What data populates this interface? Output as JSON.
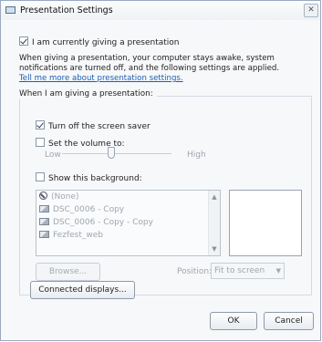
{
  "window": {
    "title": "Presentation Settings",
    "close_glyph": "✕"
  },
  "main_checkbox": {
    "label": "I am currently giving a presentation",
    "checked": true
  },
  "description": "When giving a presentation, your computer stays awake, system notifications are turned off, and the following settings are applied.",
  "link": "Tell me more about presentation settings.",
  "group": {
    "title": "When I am giving a presentation:",
    "screen_saver": {
      "label": "Turn off the screen saver",
      "checked": true
    },
    "volume": {
      "label": "Set the volume to:",
      "checked": false,
      "low": "Low",
      "high": "High",
      "level": 0.45
    },
    "background": {
      "label": "Show this background:",
      "checked": false,
      "items": [
        {
          "label": "(None)",
          "icon": "none-icon"
        },
        {
          "label": "DSC_0006 - Copy",
          "icon": "image-icon"
        },
        {
          "label": "DSC_0006 - Copy - Copy",
          "icon": "image-icon"
        },
        {
          "label": "Fezfest_web",
          "icon": "image-icon"
        }
      ]
    },
    "browse_button": "Browse...",
    "position_label": "Position:",
    "position_value": "Fit to screen"
  },
  "connected_displays_button": "Connected displays...",
  "ok_button": "OK",
  "cancel_button": "Cancel"
}
